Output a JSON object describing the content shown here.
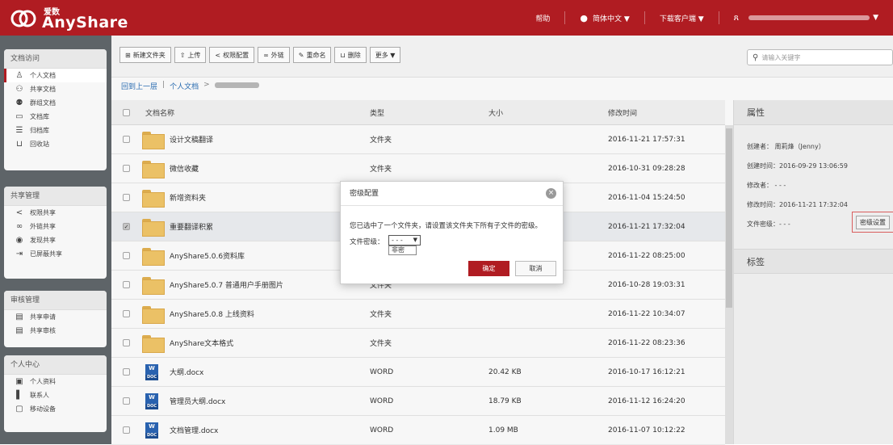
{
  "app": {
    "brand_cn": "爱数",
    "brand_en": "AnyShare"
  },
  "topnav": {
    "help": "帮助",
    "language": "简体中文 ▼",
    "download": "下载客户端 ▼",
    "user_arrow": "▼"
  },
  "sidebar": {
    "groups": [
      {
        "title": "文档访问",
        "items": [
          "个人文档",
          "共享文档",
          "群组文档",
          "文档库",
          "归档库",
          "回收站"
        ]
      },
      {
        "title": "共享管理",
        "items": [
          "权限共享",
          "外链共享",
          "发现共享",
          "已屏蔽共享"
        ]
      },
      {
        "title": "审核管理",
        "items": [
          "共享申请",
          "共享审核"
        ]
      },
      {
        "title": "个人中心",
        "items": [
          "个人资料",
          "联系人",
          "移动设备"
        ]
      }
    ]
  },
  "toolbar": {
    "buttons": [
      "新建文件夹",
      "上传",
      "权限配置",
      "外链",
      "重命名",
      "删除",
      "更多 ▼"
    ],
    "search_placeholder": "请输入关键字"
  },
  "breadcrumb": {
    "back": "回到上一层",
    "sep": "|",
    "personal": "个人文档",
    "arrow": ">"
  },
  "table": {
    "headers": [
      "文档名称",
      "类型",
      "大小",
      "修改时间"
    ],
    "rows": [
      {
        "name": "设计文稿翻译",
        "type": "文件夹",
        "size": "",
        "time": "2016-11-21 17:57:31",
        "icon": "folder"
      },
      {
        "name": "微信收藏",
        "type": "文件夹",
        "size": "",
        "time": "2016-10-31 09:28:28",
        "icon": "folder"
      },
      {
        "name": "新增资料夹",
        "type": "",
        "size": "",
        "time": "2016-11-04 15:24:50",
        "icon": "folder"
      },
      {
        "name": "重要翻译积累",
        "type": "",
        "size": "",
        "time": "2016-11-21 17:32:04",
        "icon": "folder"
      },
      {
        "name": "AnyShare5.0.6资料库",
        "type": "",
        "size": "",
        "time": "2016-11-22 08:25:00",
        "icon": "folder"
      },
      {
        "name": "AnyShare5.0.7 普通用户手册图片",
        "type": "文件夹",
        "size": "",
        "time": "2016-10-28 19:03:31",
        "icon": "folder"
      },
      {
        "name": "AnyShare5.0.8 上线资料",
        "type": "文件夹",
        "size": "",
        "time": "2016-11-22 10:34:07",
        "icon": "folder"
      },
      {
        "name": "AnyShare文本格式",
        "type": "文件夹",
        "size": "",
        "time": "2016-11-22 08:23:36",
        "icon": "folder"
      },
      {
        "name": "大纲.docx",
        "type": "WORD",
        "size": "20.42 KB",
        "time": "2016-10-17 16:12:21",
        "icon": "word"
      },
      {
        "name": "管理员大纲.docx",
        "type": "WORD",
        "size": "18.79 KB",
        "time": "2016-11-12 16:24:20",
        "icon": "word"
      },
      {
        "name": "文档管理.docx",
        "type": "WORD",
        "size": "1.09 MB",
        "time": "2016-11-07 10:12:22",
        "icon": "word"
      }
    ]
  },
  "panel": {
    "title": "属性",
    "creator": "创建者：  周莉烽（Jenny）",
    "created": "创建时间：2016-09-29 13:06:59",
    "modifier": "修改者：  - - -",
    "modified": "修改时间：2016-11-21 17:32:04",
    "level": "文件密级：- - -",
    "level_button": "密级设置",
    "tags_title": "标签"
  },
  "dialog": {
    "title": "密级配置",
    "message": "您已选中了一个文件夹，请设置该文件夹下所有子文件的密级。",
    "label": "文件密级：",
    "select_value": "- - -",
    "select_arrow": "▼",
    "option": "非密",
    "ok": "确定",
    "cancel": "取消",
    "close": "×"
  }
}
